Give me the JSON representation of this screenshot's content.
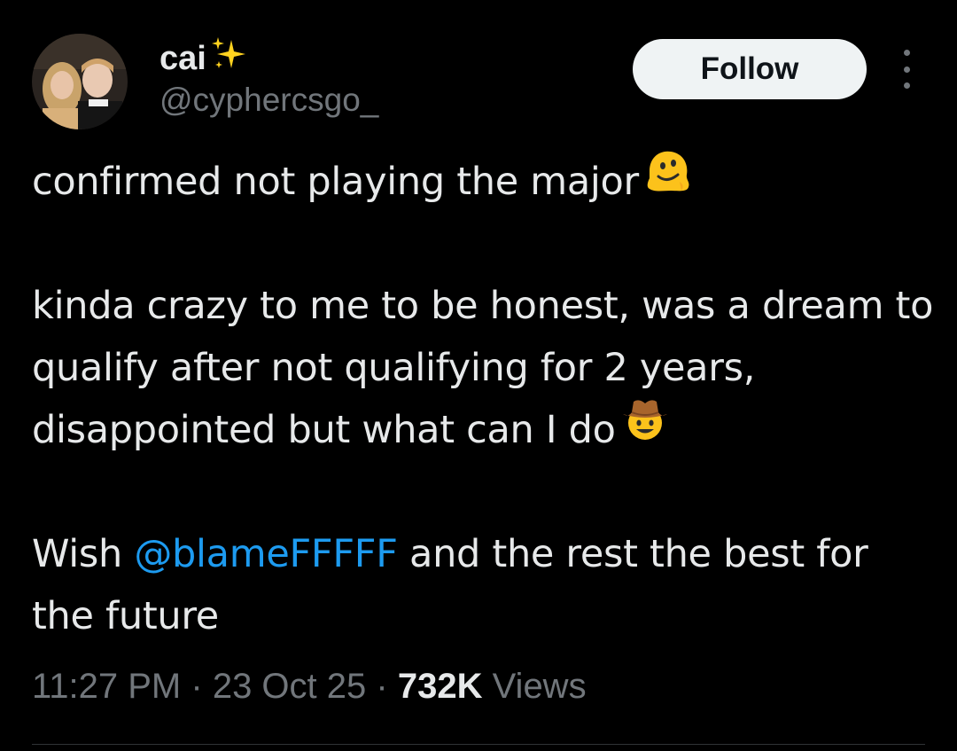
{
  "tweet": {
    "author": {
      "display_name": "cai",
      "name_decoration": "sparkles-icon",
      "handle": "@cyphercsgo_",
      "avatar": "profile-photo"
    },
    "follow_label": "Follow",
    "more_menu": "more-options-icon",
    "text": {
      "line1": "confirmed not playing the major",
      "line1_emoji": "melting-face-emoji",
      "para2": "kinda crazy to me to be honest, was a dream to qualify after not qualifying for 2 years, disappointed but what can I do",
      "para2_emoji": "cowboy-hat-face-emoji",
      "para3_prefix": "Wish ",
      "para3_mention": "@blameFFFFF",
      "para3_suffix": " and the rest the best for the future"
    },
    "meta": {
      "time": "11:27 PM",
      "separator": "·",
      "date": "23 Oct 25",
      "views_count": "732K",
      "views_label": "Views"
    }
  },
  "colors": {
    "background": "#000000",
    "text_primary": "#e7e9ea",
    "text_secondary": "#71767b",
    "link": "#1d9bf0",
    "follow_button_bg": "#eff3f4",
    "divider": "#2f3336"
  }
}
